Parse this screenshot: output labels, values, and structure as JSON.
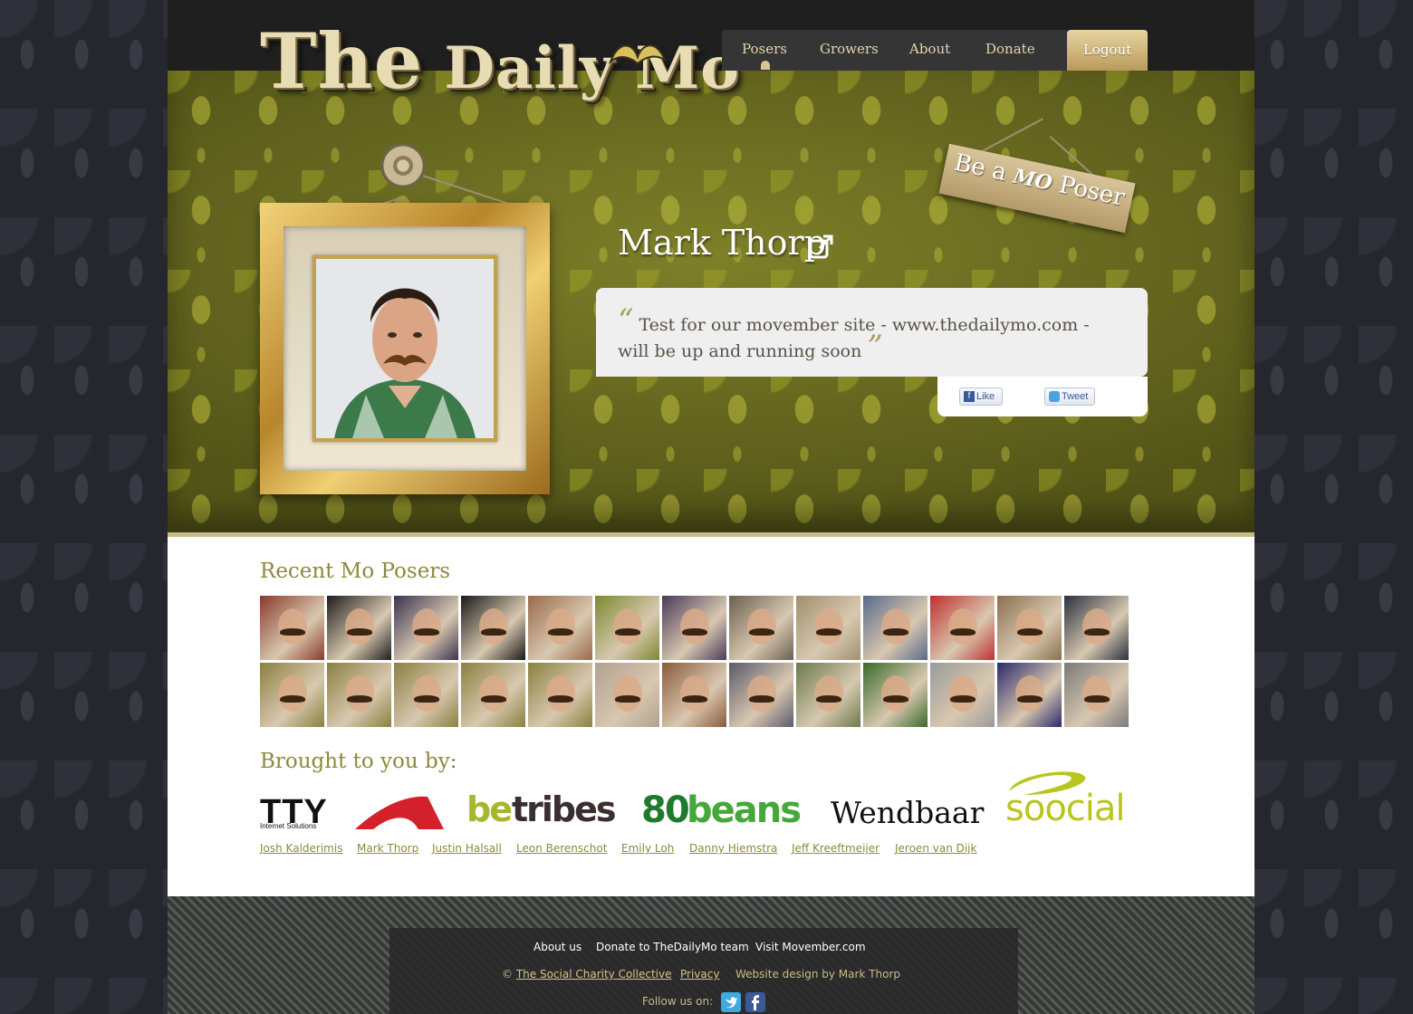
{
  "logo": {
    "the": "The",
    "daily": "Daily",
    "mo": "Mo"
  },
  "nav": {
    "items": [
      "Posers",
      "Growers",
      "About",
      "Donate"
    ],
    "logout": "Logout"
  },
  "profile": {
    "name": "Mark Thorp",
    "quote": "Test for our movember site - www.thedailymo.com - will be up and running soon",
    "sign_prefix": "Be a",
    "sign_mo": "MO",
    "sign_suffix": "Poser",
    "like_label": "Like",
    "tweet_label": "Tweet"
  },
  "sections": {
    "recent_title": "Recent Mo Posers",
    "brought_title": "Brought to you by:"
  },
  "thumbnail_colors": [
    [
      "#8a3a2a",
      "#1e1e1e",
      "#3a3450",
      "#1a1a1a",
      "#9a6a4a",
      "#7c8a30",
      "#4a3a5a",
      "#6a6050",
      "#a09070",
      "#5a6a8a",
      "#c03030",
      "#8a7050",
      "#2a3040"
    ],
    [
      "#8a8040",
      "#8a8040",
      "#8a8040",
      "#8a8040",
      "#8a8040",
      "#b0a090",
      "#8a5a3a",
      "#5a5a6a",
      "#6a7a4a",
      "#3a6a2a",
      "#9a9a9a",
      "#2a2a6a",
      "#7a7a7a"
    ]
  ],
  "sponsors": {
    "tty": "TTY",
    "tty_sub": "Internet Solutions",
    "betribes_a": "be",
    "betribes_b": "tribes",
    "beans_a": "80",
    "beans_b": "beans",
    "wendbaar": "Wendbaar",
    "soocial": "soocial"
  },
  "team": [
    "Josh Kalderimis",
    "Mark Thorp",
    "Justin Halsall",
    "Leon Berenschot",
    "Emily Loh",
    "Danny Hiemstra",
    "Jeff Kreeftmeijer",
    "Jeroen van Dijk"
  ],
  "footer": {
    "links": [
      "About us",
      "Donate to TheDailyMo team",
      "Visit Movember.com"
    ],
    "copyright": "©",
    "charity": "The Social Charity Collective",
    "privacy": "Privacy",
    "design": "Website design by Mark Thorp",
    "follow": "Follow us on:"
  },
  "colors": {
    "accent_gold": "#c9b98b",
    "olive_text": "#8c8a3c",
    "wallpaper": "#6f7120"
  }
}
